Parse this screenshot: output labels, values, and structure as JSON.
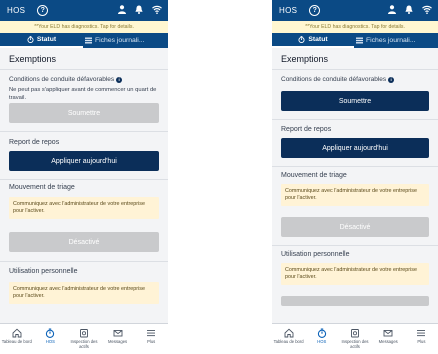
{
  "left": {
    "topbar": {
      "app": "HOS",
      "help": "?"
    },
    "banner": "**Your ELD has diagnostics. Tap for details.",
    "tabs": {
      "statut": "Statut",
      "fiches": "Fiches journali..."
    },
    "exemptions": "Exemptions",
    "conditions": {
      "title": "Conditions de conduite défavorables",
      "desc": "Ne peut pas s'appliquer avant de commencer un quart de travail.",
      "button": "Soumettre"
    },
    "report": {
      "title": "Report de repos",
      "button": "Appliquer aujourd'hui"
    },
    "triage": {
      "title": "Mouvement de triage",
      "warning": "Communiquez avec l'administrateur de votre entreprise pour l'activer.",
      "button": "Désactivé"
    },
    "personnelle": {
      "title": "Utilisation personnelle",
      "warning": "Communiquez avec l'administrateur de votre entreprise pour l'activer."
    }
  },
  "right": {
    "topbar": {
      "app": "HOS",
      "help": "?"
    },
    "banner": "**Your ELD has diagnostics. Tap for details.",
    "tabs": {
      "statut": "Statut",
      "fiches": "Fiches journali..."
    },
    "exemptions": "Exemptions",
    "conditions": {
      "title": "Conditions de conduite défavorables",
      "button": "Soumettre"
    },
    "report": {
      "title": "Report de repos",
      "button": "Appliquer aujourd'hui"
    },
    "triage": {
      "title": "Mouvement de triage",
      "warning": "Communiquez avec l'administrateur de votre entreprise pour l'activer.",
      "button": "Désactivé"
    },
    "personnelle": {
      "title": "Utilisation personnelle",
      "warning": "Communiquez avec l'administrateur de votre entreprise pour l'activer."
    }
  },
  "bottomnav": {
    "tableau": "Tableau de bord",
    "hos": "HOS",
    "inspection": "Inspection des actifs",
    "messages": "Messages",
    "plus": "Plus"
  },
  "colors": {
    "brand": "#0b4a85",
    "button": "#0b2e59",
    "active_nav": "#0b62b8",
    "warning_bg": "#fff3d6"
  }
}
